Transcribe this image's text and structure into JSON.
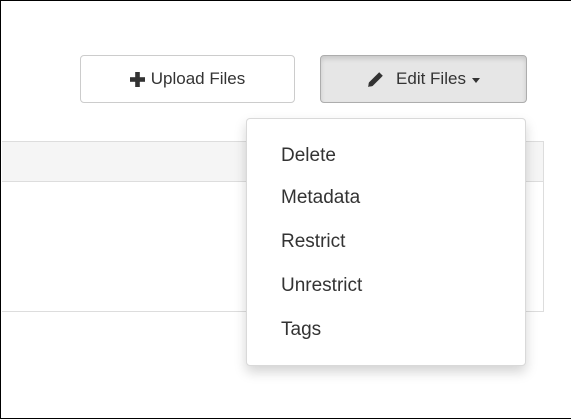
{
  "toolbar": {
    "upload_button": {
      "label": "Upload Files",
      "icon": "plus-icon"
    },
    "edit_button": {
      "label": "Edit Files",
      "icon": "pencil-icon",
      "caret": "caret-down-icon",
      "state": "open"
    }
  },
  "edit_menu": {
    "items": [
      {
        "label": "Delete"
      },
      {
        "label": "Metadata"
      },
      {
        "label": "Restrict"
      },
      {
        "label": "Unrestrict"
      },
      {
        "label": "Tags"
      }
    ]
  },
  "colors": {
    "text": "#333333",
    "button_border": "#cccccc",
    "button_active_bg": "#e6e6e6",
    "table_header_bg": "#f5f5f5",
    "table_border": "#dddddd"
  }
}
